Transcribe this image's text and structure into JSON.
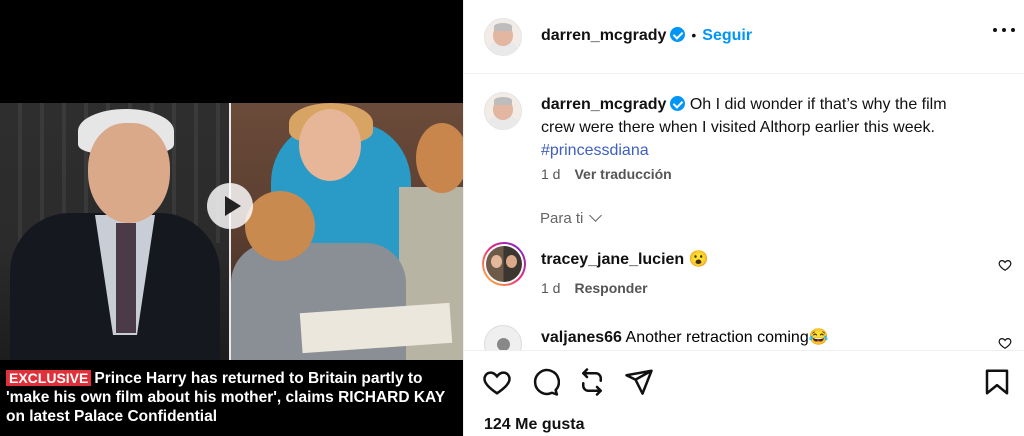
{
  "media": {
    "caption_tag": "EXCLUSIVE",
    "caption_text": "Prince Harry has returned to Britain partly to 'make his own film about his mother', claims RICHARD KAY on latest Palace Confidential"
  },
  "post": {
    "author": "darren_mcgrady",
    "follow_label": "Seguir",
    "separator": "•"
  },
  "caption_comment": {
    "author": "darren_mcgrady",
    "text": "Oh I did wonder if that’s why the film crew were there when I visited Althorp earlier this week.",
    "hashtag": "#princessdiana",
    "time": "1 d",
    "translate_label": "Ver traducción"
  },
  "sort": {
    "label": "Para ti"
  },
  "comments": [
    {
      "author": "tracey_jane_lucien",
      "text": "😮",
      "time": "1 d",
      "reply_label": "Responder"
    },
    {
      "author": "valjanes66",
      "text": "Another retraction coming😂"
    }
  ],
  "footer": {
    "likes": "124 Me gusta"
  },
  "colors": {
    "accent": "#0095f6",
    "hashtag": "#3e5fbf",
    "tag_red": "#e0313a"
  }
}
